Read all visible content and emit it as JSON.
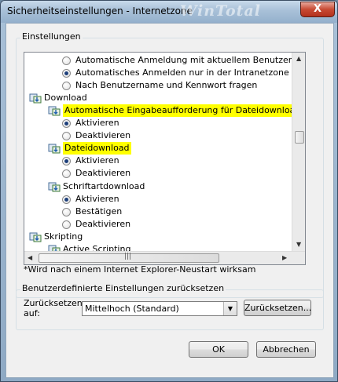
{
  "window": {
    "title": "Sicherheitseinstellungen - Internetzone",
    "watermark": "WinTotal",
    "close_glyph": "X"
  },
  "settings_group": {
    "label": "Einstellungen",
    "items": [
      {
        "type": "radio",
        "label": "Automatische Anmeldung mit aktuellem Benutzernamen u",
        "checked": false
      },
      {
        "type": "radio",
        "label": "Automatisches Anmelden nur in der Intranetzone",
        "checked": true
      },
      {
        "type": "radio",
        "label": "Nach Benutzername und Kennwort fragen",
        "checked": false
      },
      {
        "type": "category",
        "label": "Download"
      },
      {
        "type": "setting",
        "label": "Automatische Eingabeaufforderung für Dateidownloads",
        "highlight": true
      },
      {
        "type": "radio",
        "label": "Aktivieren",
        "checked": true
      },
      {
        "type": "radio",
        "label": "Deaktivieren",
        "checked": false
      },
      {
        "type": "setting",
        "label": "Dateidownload",
        "highlight": true
      },
      {
        "type": "radio",
        "label": "Aktivieren",
        "checked": true
      },
      {
        "type": "radio",
        "label": "Deaktivieren",
        "checked": false
      },
      {
        "type": "setting",
        "label": "Schriftartdownload",
        "highlight": false
      },
      {
        "type": "radio",
        "label": "Aktivieren",
        "checked": true
      },
      {
        "type": "radio",
        "label": "Bestätigen",
        "checked": false
      },
      {
        "type": "radio",
        "label": "Deaktivieren",
        "checked": false
      },
      {
        "type": "category",
        "label": "Skripting"
      },
      {
        "type": "setting",
        "label": "Active Scripting",
        "highlight": false
      }
    ],
    "note": "*Wird nach einem Internet Explorer-Neustart wirksam"
  },
  "reset_group": {
    "label": "Benutzerdefinierte Einstellungen zurücksetzen",
    "reset_to_label_line1": "Zurücksetzen",
    "reset_to_label_line2": "auf:",
    "level_selected": "Mittelhoch (Standard)",
    "reset_button": "Zurücksetzen..."
  },
  "buttons": {
    "ok": "OK",
    "cancel": "Abbrechen"
  },
  "colors": {
    "highlight": "#ffff00",
    "radio_dot": "#1d3f7a"
  }
}
